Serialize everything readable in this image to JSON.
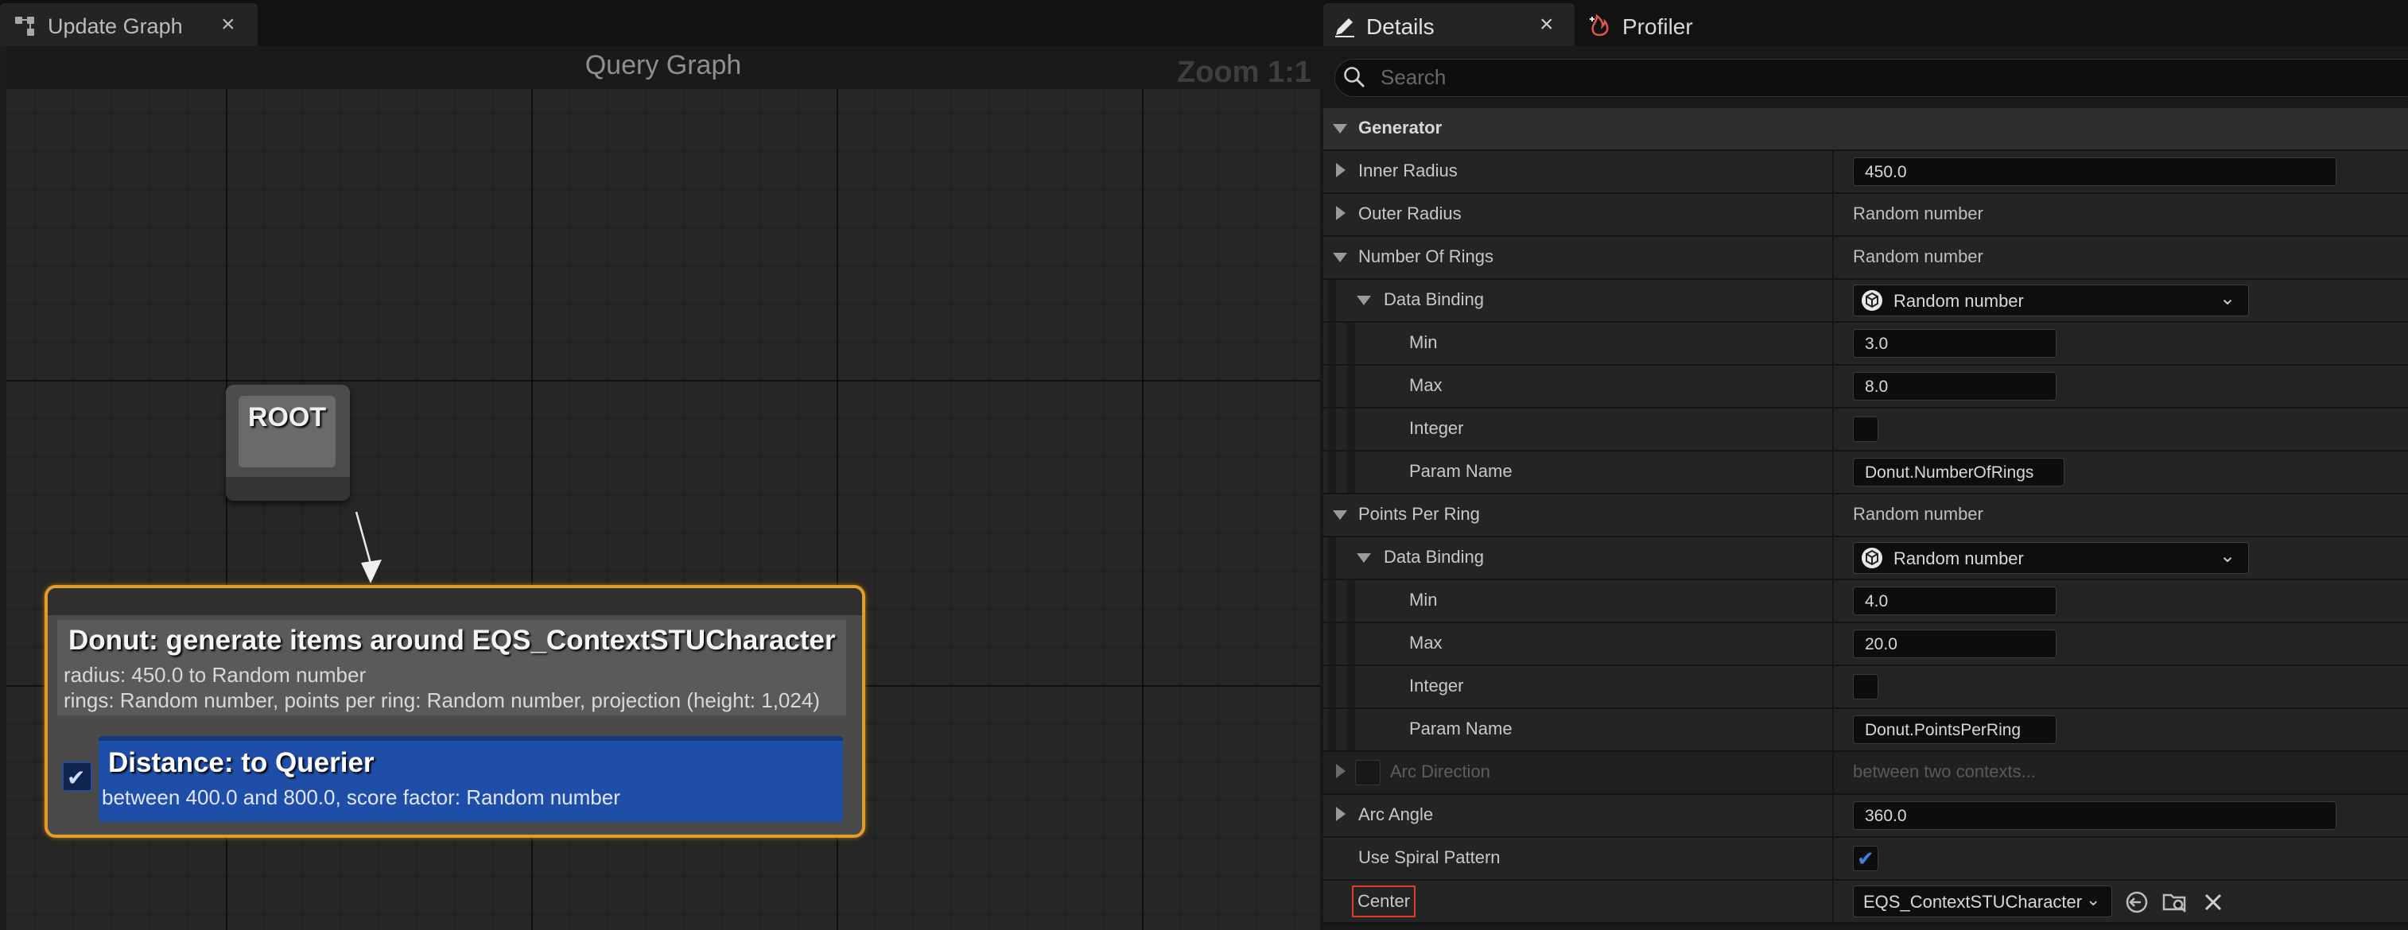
{
  "graph_tab": {
    "title": "Update Graph",
    "close": "×"
  },
  "graph": {
    "title": "Query Graph",
    "zoom": "Zoom 1:1",
    "root_label": "ROOT",
    "generator_node": {
      "title": "Donut: generate items around EQS_ContextSTUCharacter",
      "line1": "radius: 450.0 to Random number",
      "line2": "rings: Random number, points per ring: Random number, projection (height: 1,024)"
    },
    "test_node": {
      "title": "Distance: to Querier",
      "description": "between 400.0 and 800.0, score factor: Random number",
      "enabled": true
    }
  },
  "details_tab": {
    "title": "Details",
    "close": "×"
  },
  "profiler_tab": {
    "title": "Profiler"
  },
  "search": {
    "placeholder": "Search"
  },
  "details": {
    "category": "Generator",
    "inner_radius": {
      "label": "Inner Radius",
      "value": "450.0"
    },
    "outer_radius": {
      "label": "Outer Radius",
      "value": "Random number"
    },
    "number_of_rings": {
      "label": "Number Of Rings",
      "value": "Random number",
      "binding_label": "Data Binding",
      "binding_value": "Random number",
      "min_label": "Min",
      "min": "3.0",
      "max_label": "Max",
      "max": "8.0",
      "integer_label": "Integer",
      "integer": false,
      "param_label": "Param Name",
      "param": "Donut.NumberOfRings"
    },
    "points_per_ring": {
      "label": "Points Per Ring",
      "value": "Random number",
      "binding_label": "Data Binding",
      "binding_value": "Random number",
      "min_label": "Min",
      "min": "4.0",
      "max_label": "Max",
      "max": "20.0",
      "integer_label": "Integer",
      "integer": false,
      "param_label": "Param Name",
      "param": "Donut.PointsPerRing"
    },
    "arc_direction": {
      "label": "Arc Direction",
      "value": "between two contexts..."
    },
    "arc_angle": {
      "label": "Arc Angle",
      "value": "360.0"
    },
    "spiral": {
      "label": "Use Spiral Pattern",
      "checked": true
    },
    "center": {
      "label": "Center",
      "value": "EQS_ContextSTUCharacter"
    }
  },
  "colors": {
    "selection_outline": "#e39d2b",
    "test_block": "#1f4ea8",
    "checkbox_accent": "#3f7fe4",
    "center_highlight": "#e23a2a"
  }
}
